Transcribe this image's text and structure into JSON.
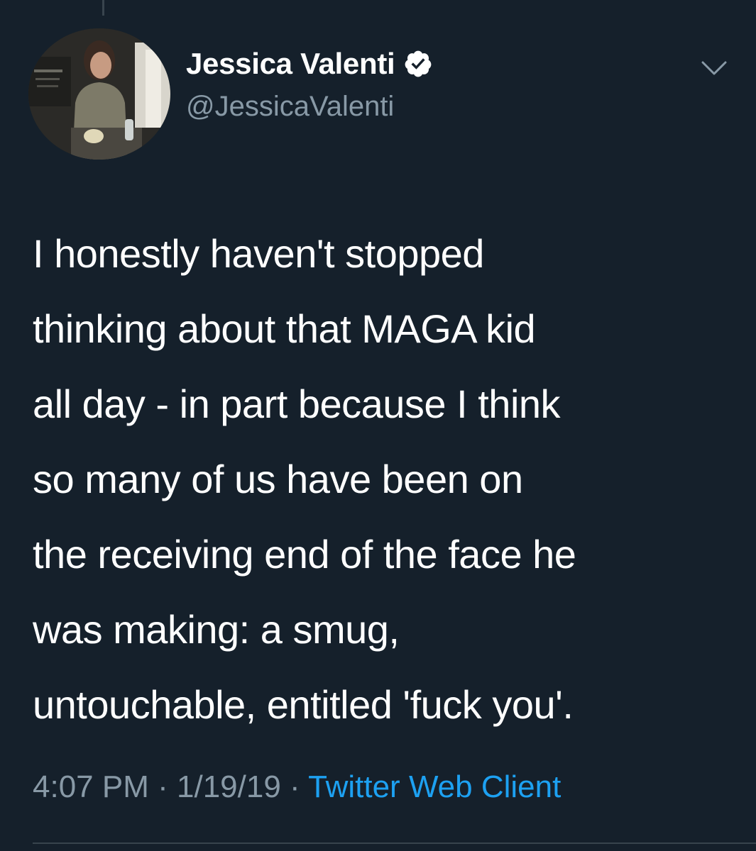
{
  "tweet": {
    "author": {
      "display_name": "Jessica Valenti",
      "handle": "@JessicaValenti",
      "verified": true
    },
    "text_lines": [
      "I honestly haven't stopped",
      "thinking about that MAGA kid",
      "all day - in part because I think",
      "so many of us have been on",
      "the receiving end of the face he",
      "was making: a smug,",
      "untouchable, entitled 'fuck you'."
    ],
    "time": "4:07 PM",
    "date": "1/19/19",
    "separator": "·",
    "source": "Twitter Web Client"
  },
  "icons": {
    "verified": "verified-badge-icon",
    "menu": "chevron-down-icon"
  },
  "colors": {
    "background": "#15202b",
    "text": "#ffffff",
    "secondary_text": "#8899a6",
    "link": "#1da1f2",
    "divider": "#38444d"
  }
}
